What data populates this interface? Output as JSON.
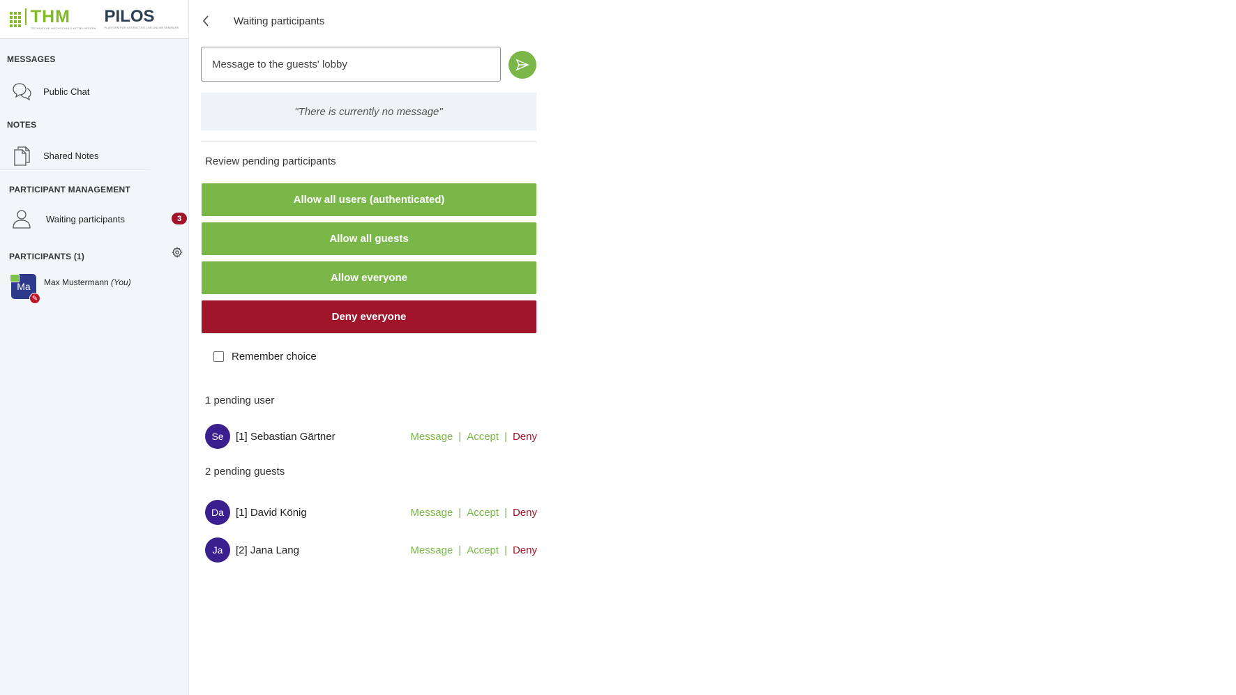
{
  "sidebar": {
    "logo_thm": "THM",
    "logo_thm_sub": "TECHNISCHE HOCHSCHULE MITTELHESSEN",
    "logo_pilos": "PILOS",
    "logo_pilos_sub": "PLATFORM FOR INTERACTIVE LIVE-ONLINE SEMINARS",
    "sections": {
      "messages": "MESSAGES",
      "notes": "NOTES",
      "participant_management": "PARTICIPANT MANAGEMENT",
      "participants": "PARTICIPANTS (1)"
    },
    "items": {
      "public_chat": "Public Chat",
      "shared_notes": "Shared Notes",
      "waiting_participants": "Waiting participants",
      "waiting_count": "3"
    },
    "user": {
      "initials": "Ma",
      "name": "Max Mustermann",
      "you_label": "(You)"
    }
  },
  "panel": {
    "title": "Waiting participants",
    "message_placeholder": "Message to the guests' lobby",
    "no_message": "\"There is currently no message\"",
    "review_title": "Review pending participants",
    "buttons": {
      "allow_authenticated": "Allow all users (authenticated)",
      "allow_guests": "Allow all guests",
      "allow_everyone": "Allow everyone",
      "deny_everyone": "Deny everyone"
    },
    "remember_choice": "Remember choice",
    "pending_users_title": "1 pending user",
    "pending_guests_title": "2 pending guests",
    "action_labels": {
      "message": "Message",
      "accept": "Accept",
      "deny": "Deny",
      "separator": "|"
    },
    "pending_users": [
      {
        "initials": "Se",
        "name": "[1] Sebastian Gärtner"
      }
    ],
    "pending_guests": [
      {
        "initials": "Da",
        "name": "[1] David König"
      },
      {
        "initials": "Ja",
        "name": "[2] Jana Lang"
      }
    ]
  },
  "colors": {
    "accent_green": "#7ab648",
    "deny_red": "#a0152a",
    "avatar_purple": "#3b1f8f"
  }
}
